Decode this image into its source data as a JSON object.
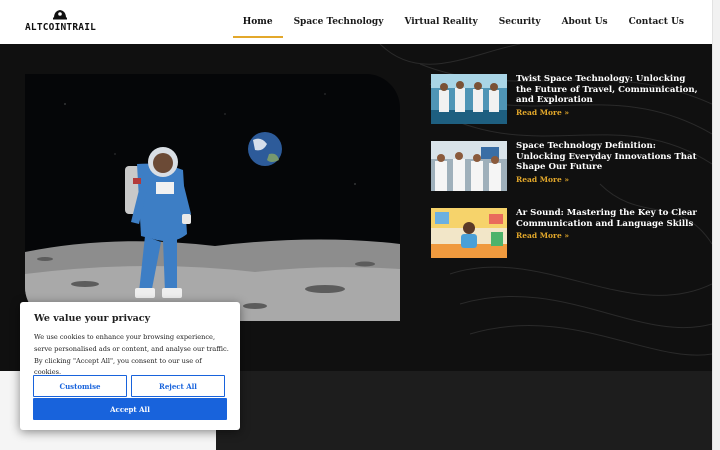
{
  "logo": {
    "text": "ALTCOINTRAIL",
    "icon": "spaceship-icon"
  },
  "nav": {
    "items": [
      {
        "label": "Home",
        "active": true
      },
      {
        "label": "Space Technology"
      },
      {
        "label": "Virtual Reality"
      },
      {
        "label": "Security"
      },
      {
        "label": "About Us"
      },
      {
        "label": "Contact Us"
      }
    ]
  },
  "articles": [
    {
      "title": "Twist Space Technology: Unlocking the Future of Travel, Communication, and Exploration",
      "read_more": "Read More »"
    },
    {
      "title": "Space Technology Definition: Unlocking Everyday Innovations That Shape Our Future",
      "read_more": "Read More »"
    },
    {
      "title": "Ar Sound: Mastering the Key to Clear Communication and Language Skills",
      "read_more": "Read More »"
    }
  ],
  "cookie": {
    "title": "We value your privacy",
    "text": "We use cookies to enhance your browsing experience, serve personalised ads or content, and analyse our traffic. By clicking \"Accept All\", you consent to our use of cookies.",
    "customise": "Customise",
    "reject": "Reject All",
    "accept": "Accept All"
  },
  "colors": {
    "accent": "#e3a82b",
    "cookie_blue": "#1863dc",
    "background": "#101010"
  }
}
